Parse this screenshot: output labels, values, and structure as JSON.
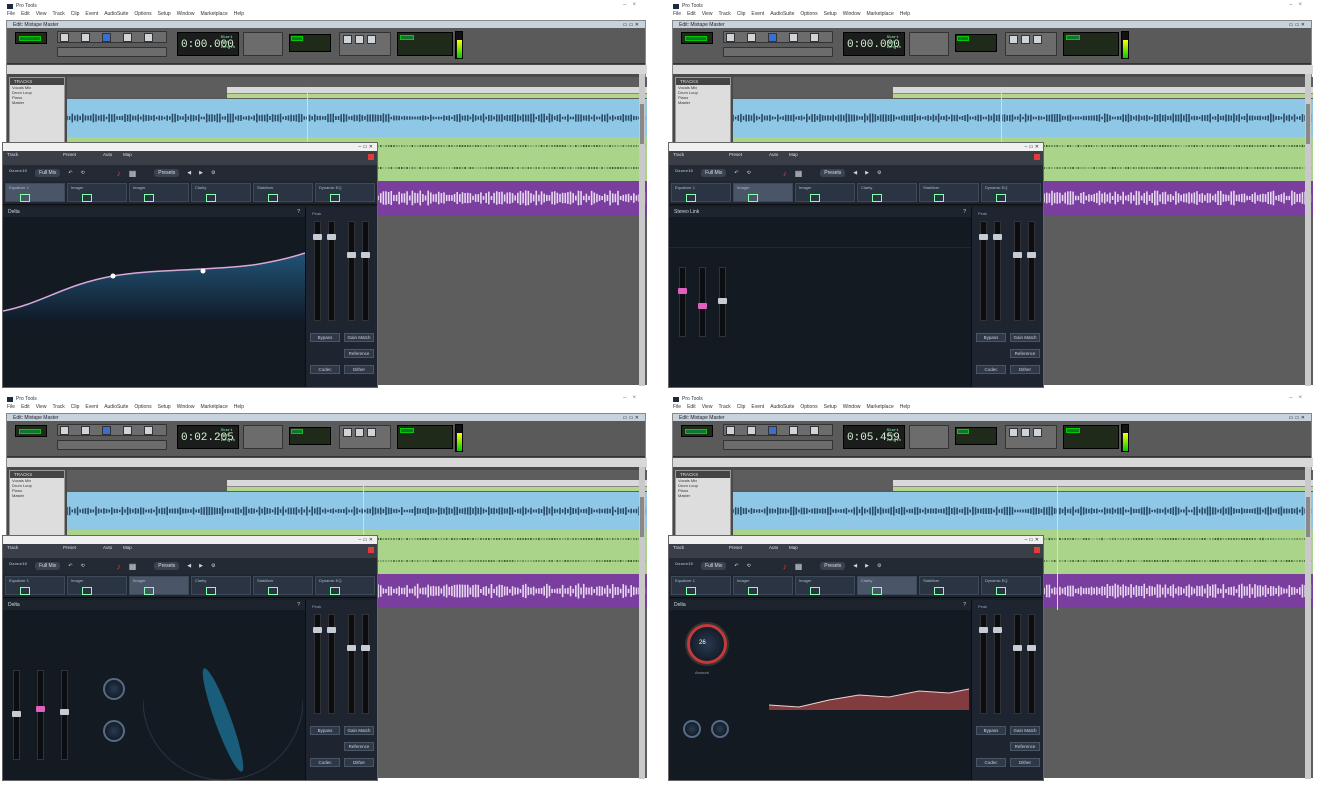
{
  "screens": [
    {
      "id": "a",
      "app_title": "Pro Tools",
      "window_title": "Edit: Mixtape Master",
      "time": "0:00.000",
      "ozone_module": "Equalizer 1",
      "ozone_sub": "Delta"
    },
    {
      "id": "b",
      "app_title": "Pro Tools",
      "window_title": "Edit: Mixtape Master",
      "time": "0:00.000",
      "ozone_module": "Imager",
      "ozone_sub": "Stereo Link"
    },
    {
      "id": "c",
      "app_title": "Pro Tools",
      "window_title": "Edit: Mixtape Master",
      "time": "0:02.205",
      "ozone_module": "Imager",
      "ozone_sub": "Delta"
    },
    {
      "id": "d",
      "app_title": "Pro Tools",
      "window_title": "Edit: Mixtape Master",
      "time": "0:05.459",
      "ozone_module": "Clarity",
      "ozone_sub": "Delta"
    }
  ],
  "menu": [
    "File",
    "Edit",
    "View",
    "Track",
    "Clip",
    "Event",
    "AudioSuite",
    "Options",
    "Setup",
    "Window",
    "Marketplace",
    "Help"
  ],
  "tracks_panel": {
    "title": "TRACKS",
    "items": [
      "Vocals Mix",
      "Drum Loop",
      "Piano",
      "Master"
    ]
  },
  "ozone": {
    "logo": "Ozone",
    "logo_sup": "10",
    "preset_label": "Full Mix",
    "presets": "Presets",
    "header_track": "Track",
    "header_preset": "Preset",
    "header_auto": "Auto",
    "header_map": "Map",
    "bypass": "Bypass",
    "gain_match": "Gain Match",
    "reference": "Reference",
    "codec": "Codec",
    "dither": "Dither",
    "amount": "Amount",
    "peak": "Peak",
    "amount_val": "26"
  },
  "modules": [
    "Equalizer 1",
    "Imager",
    "Imager",
    "Clarity",
    "Stabilizer",
    "Dynamic EQ"
  ],
  "colors": {
    "clip_blue": "#8ec8e6",
    "clip_green": "#a9d48a",
    "clip_purple": "#7a3f9e",
    "ozone_bg": "#1a1e25",
    "accent_red": "#e13c3c"
  }
}
